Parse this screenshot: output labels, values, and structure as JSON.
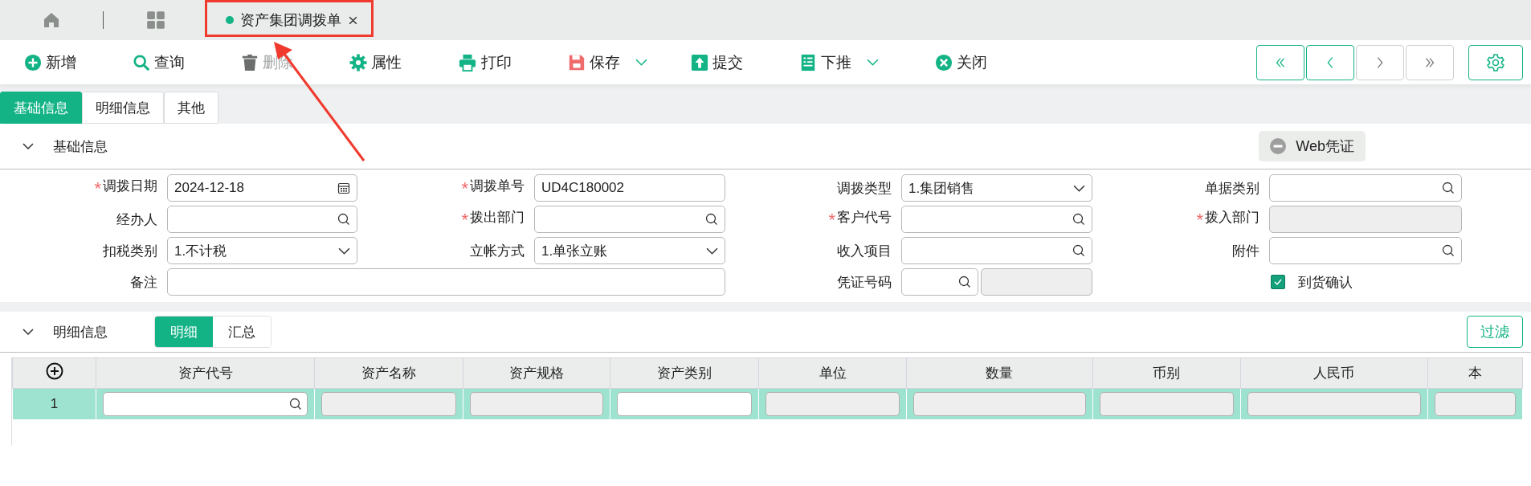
{
  "top_bar": {
    "tab": {
      "title": "资产集团调拨单",
      "selected": true
    }
  },
  "annotation": {
    "kind": "box_with_arrow"
  },
  "toolbar": [
    {
      "label": "新增",
      "disabled": false,
      "dropdown": false
    },
    {
      "label": "查询",
      "disabled": false,
      "dropdown": false
    },
    {
      "label": "删除",
      "disabled": true,
      "dropdown": false
    },
    {
      "label": "属性",
      "disabled": false,
      "dropdown": false
    },
    {
      "label": "打印",
      "disabled": false,
      "dropdown": false
    },
    {
      "label": "保存",
      "disabled": false,
      "dropdown": true
    },
    {
      "label": "提交",
      "disabled": false,
      "dropdown": false
    },
    {
      "label": "下推",
      "disabled": false,
      "dropdown": true
    },
    {
      "label": "关闭",
      "disabled": false,
      "dropdown": false
    }
  ],
  "nav_buttons": [
    {
      "disabled": false
    },
    {
      "disabled": false
    },
    {
      "disabled": true
    },
    {
      "disabled": true
    }
  ],
  "tabs": [
    {
      "label": "基础信息",
      "selected": true
    },
    {
      "label": "明细信息",
      "selected": false
    },
    {
      "label": "其他",
      "selected": false
    }
  ],
  "basic_section": {
    "title": "基础信息",
    "expanded": true,
    "voucher_button": "Web凭证",
    "fields": [
      {
        "label": "调拨日期",
        "required_mark": "*",
        "kind": "date",
        "value": "2024-12-18"
      },
      {
        "label": "调拨单号",
        "required_mark": "*",
        "kind": "text",
        "value": "UD4C180002"
      },
      {
        "label": "调拨类型",
        "kind": "select",
        "value": "1.集团销售"
      },
      {
        "label": "单据类别",
        "kind": "lookup"
      },
      {
        "label": "经办人",
        "kind": "lookup"
      },
      {
        "label": "拨出部门",
        "required_mark": "*",
        "kind": "lookup"
      },
      {
        "label": "客户代号",
        "required_mark": "*",
        "kind": "lookup"
      },
      {
        "label": "拨入部门",
        "required_mark": "*",
        "kind": "disabled"
      },
      {
        "label": "扣税类别",
        "kind": "select",
        "value": "1.不计税"
      },
      {
        "label": "立帐方式",
        "kind": "select",
        "value": "1.单张立账"
      },
      {
        "label": "收入项目",
        "kind": "lookup"
      },
      {
        "label": "附件",
        "kind": "lookup"
      },
      {
        "label": "备注",
        "kind": "wide_text"
      },
      {
        "label": "凭证号码",
        "kind": "lookup_pair"
      },
      {
        "label": "到货确认",
        "kind": "checkbox",
        "checked": true
      }
    ]
  },
  "detail_section": {
    "title": "明细信息",
    "expanded": true,
    "views": [
      {
        "label": "明细",
        "selected": true
      },
      {
        "label": "汇总",
        "selected": false
      }
    ],
    "filter_button": "过滤",
    "table": {
      "columns": [
        "资产代号",
        "资产名称",
        "资产规格",
        "资产类别",
        "单位",
        "数量",
        "币别",
        "人民币",
        "本"
      ],
      "rows": [
        {
          "number": "1",
          "selected": true,
          "cells": [
            {
              "kind": "lookup"
            },
            {
              "kind": "disabled"
            },
            {
              "kind": "disabled"
            },
            {
              "kind": "text"
            },
            {
              "kind": "disabled"
            },
            {
              "kind": "disabled"
            },
            {
              "kind": "disabled"
            },
            {
              "kind": "disabled"
            },
            {
              "kind": "disabled"
            }
          ]
        }
      ]
    }
  }
}
